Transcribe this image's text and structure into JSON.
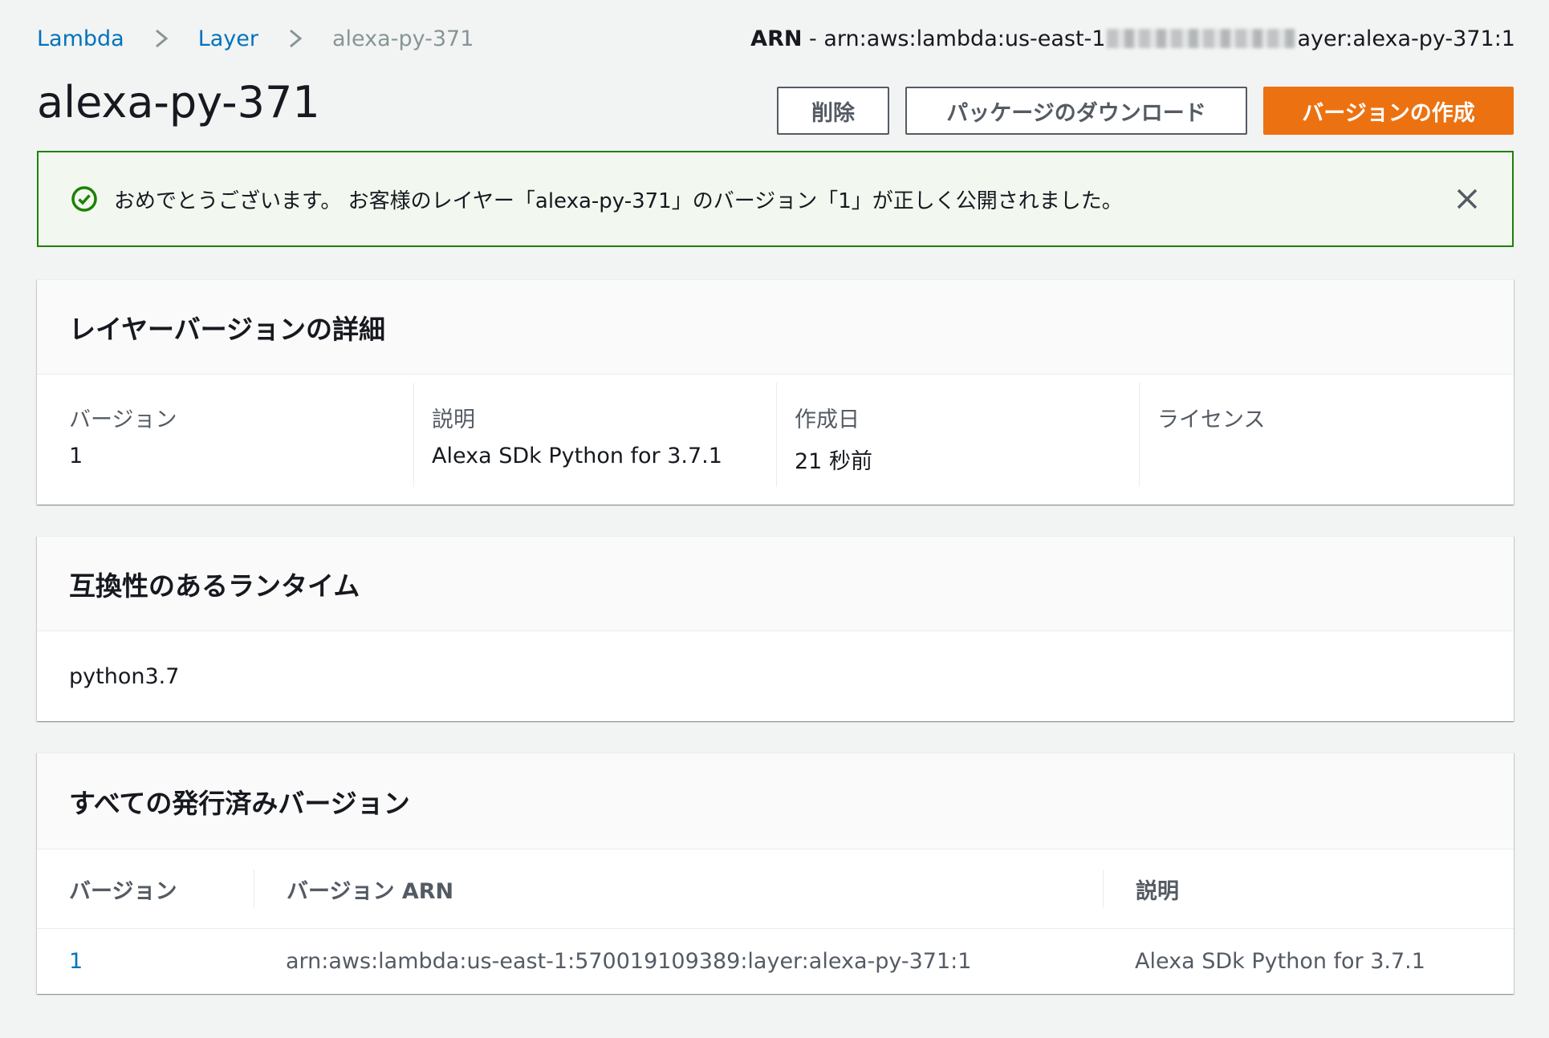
{
  "breadcrumb": {
    "items": [
      "Lambda",
      "Layer",
      "alexa-py-371"
    ]
  },
  "arn_header": {
    "label": "ARN",
    "separator": " - ",
    "prefix": "arn:aws:lambda:us-east-1",
    "suffix": "ayer:alexa-py-371:1"
  },
  "page": {
    "title": "alexa-py-371"
  },
  "buttons": {
    "delete": "削除",
    "download": "パッケージのダウンロード",
    "create_version": "バージョンの作成"
  },
  "flash": {
    "message": "おめでとうございます。 お客様のレイヤー「alexa-py-371」のバージョン「1」が正しく公開されました。",
    "close_icon": "close-icon",
    "success_icon": "check-circle-icon"
  },
  "details": {
    "title": "レイヤーバージョンの詳細",
    "fields": [
      {
        "label": "バージョン",
        "value": "1"
      },
      {
        "label": "説明",
        "value": "Alexa SDk Python for 3.7.1"
      },
      {
        "label": "作成日",
        "value": "21 秒前"
      },
      {
        "label": "ライセンス",
        "value": ""
      }
    ]
  },
  "runtimes": {
    "title": "互換性のあるランタイム",
    "items": [
      "python3.7"
    ]
  },
  "versions": {
    "title": "すべての発行済みバージョン",
    "columns": [
      "バージョン",
      "バージョン ARN",
      "説明"
    ],
    "rows": [
      {
        "version": "1",
        "arn": "arn:aws:lambda:us-east-1:570019109389:layer:alexa-py-371:1",
        "description": "Alexa SDk Python for 3.7.1"
      }
    ]
  },
  "colors": {
    "primary": "#ec7211",
    "link": "#0073bb",
    "success": "#1d8102"
  }
}
